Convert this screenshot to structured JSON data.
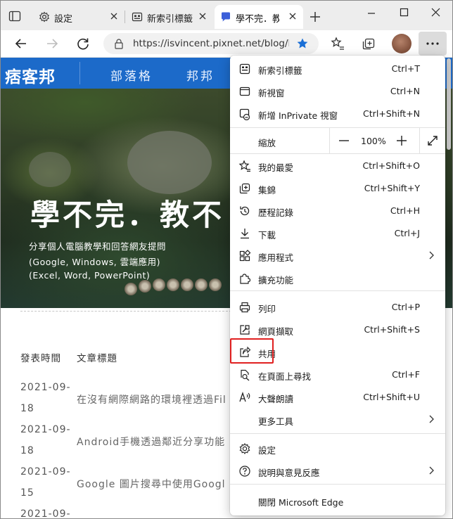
{
  "browser": {
    "tabs": [
      {
        "title": "設定",
        "icon": "gear-icon",
        "active": false
      },
      {
        "title": "新索引標籤",
        "icon": "new-tab-page-icon",
        "active": false
      },
      {
        "title": "學不完．教",
        "icon": "pixnet-favicon",
        "active": true
      }
    ],
    "url": "https://isvincent.pixnet.net/blog/l...",
    "window_controls": [
      "minimize",
      "maximize",
      "close"
    ]
  },
  "page": {
    "logo": "痞客邦",
    "nav": [
      "部落格",
      "邦邦"
    ],
    "hero_title": "學不完．教不",
    "hero_subtitle": [
      "分享個人電腦教學和回答網友提問",
      "(Google, Windows, 雲端應用)",
      "(Excel, Word, PowerPoint)"
    ],
    "columns": {
      "date": "發表時間",
      "title": "文章標題"
    },
    "posts": [
      {
        "date_line1": "2021-09-",
        "date_line2": "18",
        "title": "在沒有網際網路的環境裡透過Fil"
      },
      {
        "date_line1": "2021-09-",
        "date_line2": "18",
        "title": "Android手機透過鄰近分享功能"
      },
      {
        "date_line1": "2021-09-",
        "date_line2": "15",
        "title": "Google 圖片搜尋中使用Googl"
      },
      {
        "date_line1": "2021-09-",
        "date_line2": "",
        "title": ""
      }
    ]
  },
  "menu": {
    "items_top": [
      {
        "label": "新索引標籤",
        "shortcut": "Ctrl+T",
        "icon": "new-tab-icon"
      },
      {
        "label": "新視窗",
        "shortcut": "Ctrl+N",
        "icon": "window-icon"
      },
      {
        "label": "新增 InPrivate 視窗",
        "shortcut": "Ctrl+Shift+N",
        "icon": "inprivate-icon"
      }
    ],
    "zoom": {
      "label": "縮放",
      "value": "100%"
    },
    "items_mid": [
      {
        "label": "我的最愛",
        "shortcut": "Ctrl+Shift+O",
        "icon": "favorites-icon"
      },
      {
        "label": "集錦",
        "shortcut": "Ctrl+Shift+Y",
        "icon": "collections-icon"
      },
      {
        "label": "歷程記錄",
        "shortcut": "Ctrl+H",
        "icon": "history-icon"
      },
      {
        "label": "下載",
        "shortcut": "Ctrl+J",
        "icon": "download-icon"
      },
      {
        "label": "應用程式",
        "shortcut": "",
        "icon": "apps-icon",
        "submenu": true
      },
      {
        "label": "擴充功能",
        "shortcut": "",
        "icon": "extensions-icon"
      }
    ],
    "items_tools": [
      {
        "label": "列印",
        "shortcut": "Ctrl+P",
        "icon": "print-icon"
      },
      {
        "label": "網頁擷取",
        "shortcut": "Ctrl+Shift+S",
        "icon": "web-capture-icon"
      },
      {
        "label": "共用",
        "shortcut": "",
        "icon": "share-icon"
      },
      {
        "label": "在頁面上尋找",
        "shortcut": "Ctrl+F",
        "icon": "find-icon"
      },
      {
        "label": "大聲朗讀",
        "shortcut": "Ctrl+Shift+U",
        "icon": "read-aloud-icon"
      },
      {
        "label": "更多工具",
        "shortcut": "",
        "icon": "",
        "submenu": true
      }
    ],
    "items_bottom": [
      {
        "label": "設定",
        "shortcut": "",
        "icon": "settings-icon"
      },
      {
        "label": "說明與意見反應",
        "shortcut": "",
        "icon": "help-icon",
        "submenu": true
      }
    ],
    "close": {
      "label": "關閉 Microsoft Edge"
    }
  },
  "colors": {
    "accent": "#1c6ac9",
    "favorite_star": "#1a6fd6",
    "highlight": "#e02020"
  }
}
